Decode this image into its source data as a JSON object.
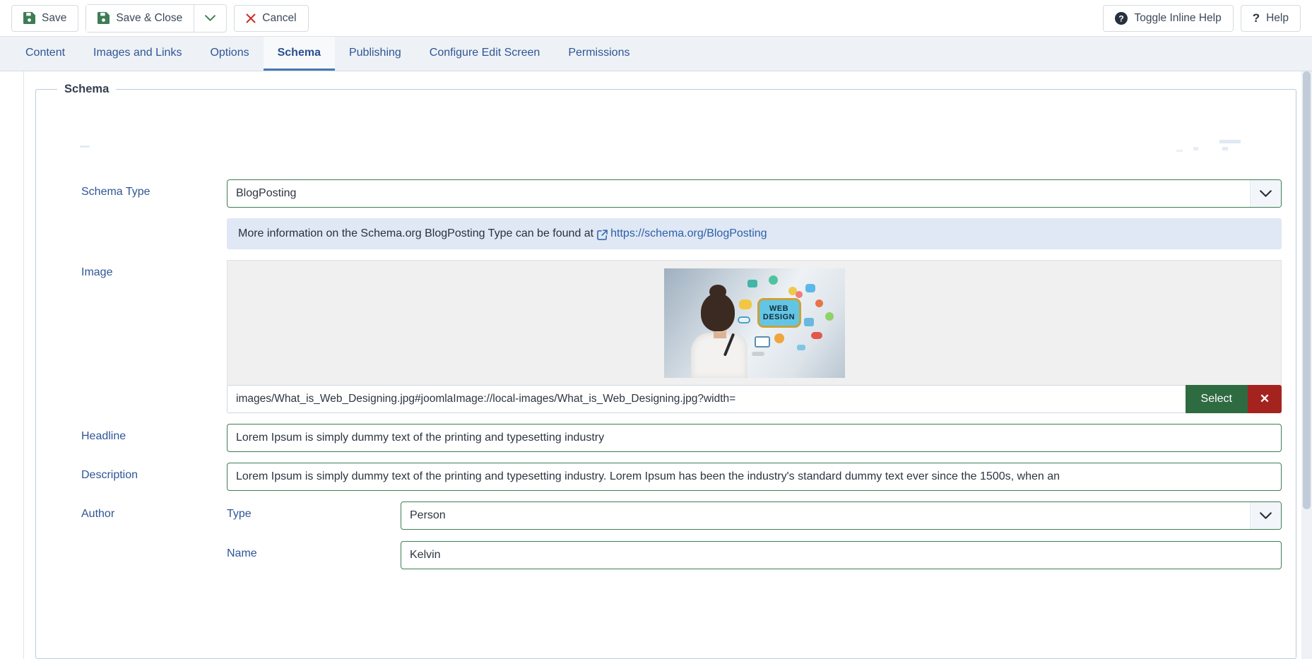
{
  "toolbar": {
    "save_label": "Save",
    "save_close_label": "Save & Close",
    "save_close_caret": "⌄",
    "cancel_label": "Cancel",
    "cancel_icon": "✕",
    "toggle_inline_help_label": "Toggle Inline Help",
    "help_label": "Help",
    "help_icon": "?"
  },
  "tabs": [
    {
      "label": "Content",
      "active": false
    },
    {
      "label": "Images and Links",
      "active": false
    },
    {
      "label": "Options",
      "active": false
    },
    {
      "label": "Schema",
      "active": true
    },
    {
      "label": "Publishing",
      "active": false
    },
    {
      "label": "Configure Edit Screen",
      "active": false
    },
    {
      "label": "Permissions",
      "active": false
    }
  ],
  "fieldset": {
    "legend": "Schema"
  },
  "fields": {
    "schema_type": {
      "label": "Schema Type",
      "value": "BlogPosting"
    },
    "info_alert": {
      "text": "More information on the Schema.org BlogPosting Type can be found at",
      "link_text": "https://schema.org/BlogPosting"
    },
    "image": {
      "label": "Image",
      "url_value": "images/What_is_Web_Designing.jpg#joomlaImage://local-images/What_is_Web_Designing.jpg?width=",
      "select_label": "Select",
      "clear_label": "✕",
      "thumbnail_text_line1": "WEB",
      "thumbnail_text_line2": "DESIGN"
    },
    "headline": {
      "label": "Headline",
      "value": "Lorem Ipsum is simply dummy text of the printing and typesetting industry"
    },
    "description": {
      "label": "Description",
      "value": "Lorem Ipsum is simply dummy text of the printing and typesetting industry. Lorem Ipsum has been the industry's standard dummy text ever since the 1500s, when an"
    },
    "author": {
      "label": "Author",
      "type_label": "Type",
      "type_value": "Person",
      "name_label": "Name",
      "name_value": "Kelvin"
    }
  },
  "colors": {
    "accent_blue": "#2f5596",
    "active_tab_underline": "#4877b7",
    "save_green": "#3e7d54",
    "select_green": "#2f6b40",
    "clear_red": "#a5231f",
    "cancel_red": "#c9302c",
    "alert_bg": "#dfe8f4",
    "tabbar_bg": "#eef2f6"
  }
}
